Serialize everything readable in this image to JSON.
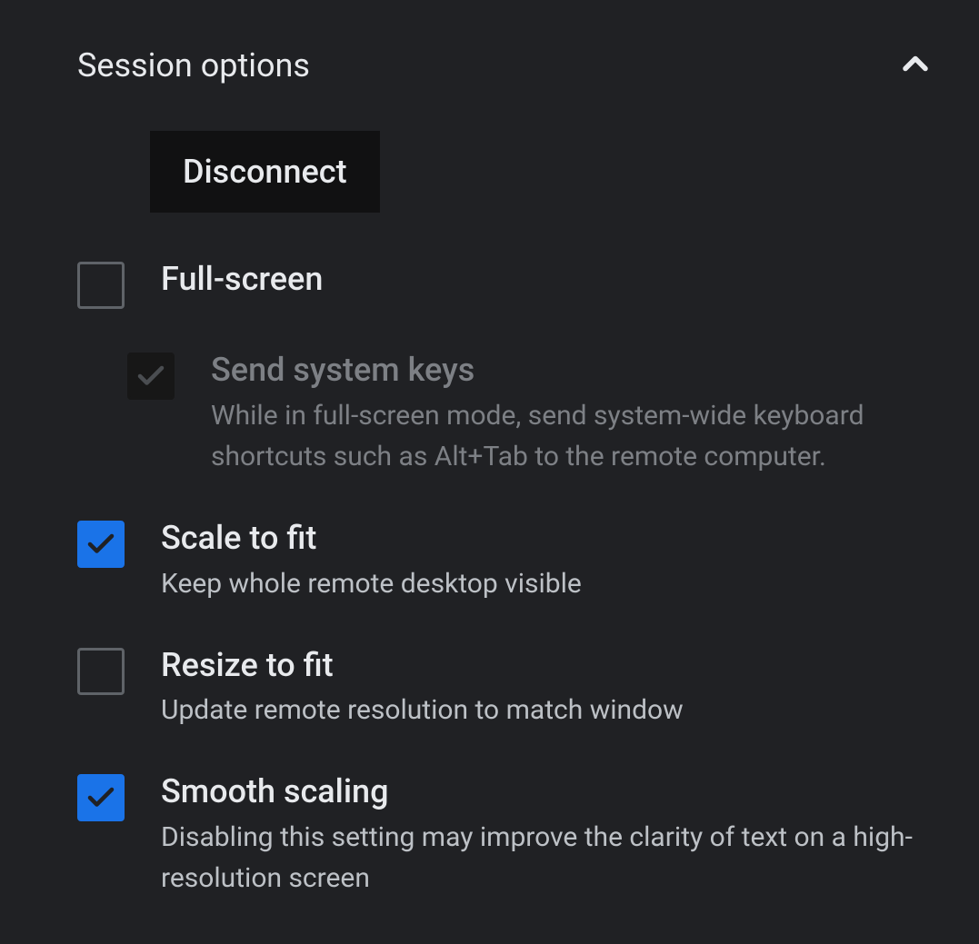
{
  "header": {
    "title": "Session options"
  },
  "disconnect": {
    "label": "Disconnect"
  },
  "options": {
    "fullscreen": {
      "title": "Full-screen",
      "checked": false,
      "disabled": false
    },
    "send_system_keys": {
      "title": "Send system keys",
      "desc": "While in full-screen mode, send system-wide keyboard shortcuts such as Alt+Tab to the remote computer.",
      "checked": true,
      "disabled": true
    },
    "scale_to_fit": {
      "title": "Scale to fit",
      "desc": "Keep whole remote desktop visible",
      "checked": true,
      "disabled": false
    },
    "resize_to_fit": {
      "title": "Resize to fit",
      "desc": "Update remote resolution to match window",
      "checked": false,
      "disabled": false
    },
    "smooth_scaling": {
      "title": "Smooth scaling",
      "desc": "Disabling this setting may improve the clarity of text on a high-resolution screen",
      "checked": true,
      "disabled": false
    }
  }
}
